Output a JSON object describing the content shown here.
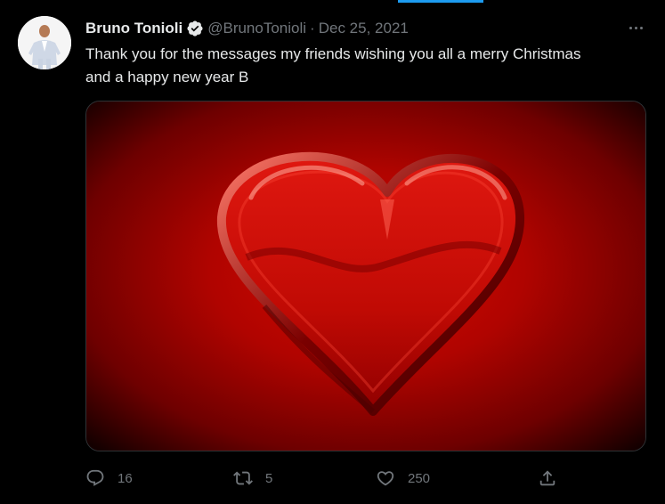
{
  "tweet": {
    "display_name": "Bruno Tonioli",
    "handle": "@BrunoTonioli",
    "separator": "·",
    "date": "Dec 25, 2021",
    "text": "Thank you for the messages my friends wishing you all a merry Christmas\nand a happy new year B",
    "verified": true
  },
  "actions": {
    "reply_count": "16",
    "retweet_count": "5",
    "like_count": "250"
  },
  "icons": {
    "verified": "verified-badge-icon",
    "more": "more-options-icon",
    "reply": "reply-icon",
    "retweet": "retweet-icon",
    "like": "heart-icon",
    "share": "share-icon"
  },
  "colors": {
    "background": "#000000",
    "text": "#e7e9ea",
    "secondary_text": "#71767b",
    "accent": "#1d9bf0",
    "media_red": "#c80800"
  }
}
